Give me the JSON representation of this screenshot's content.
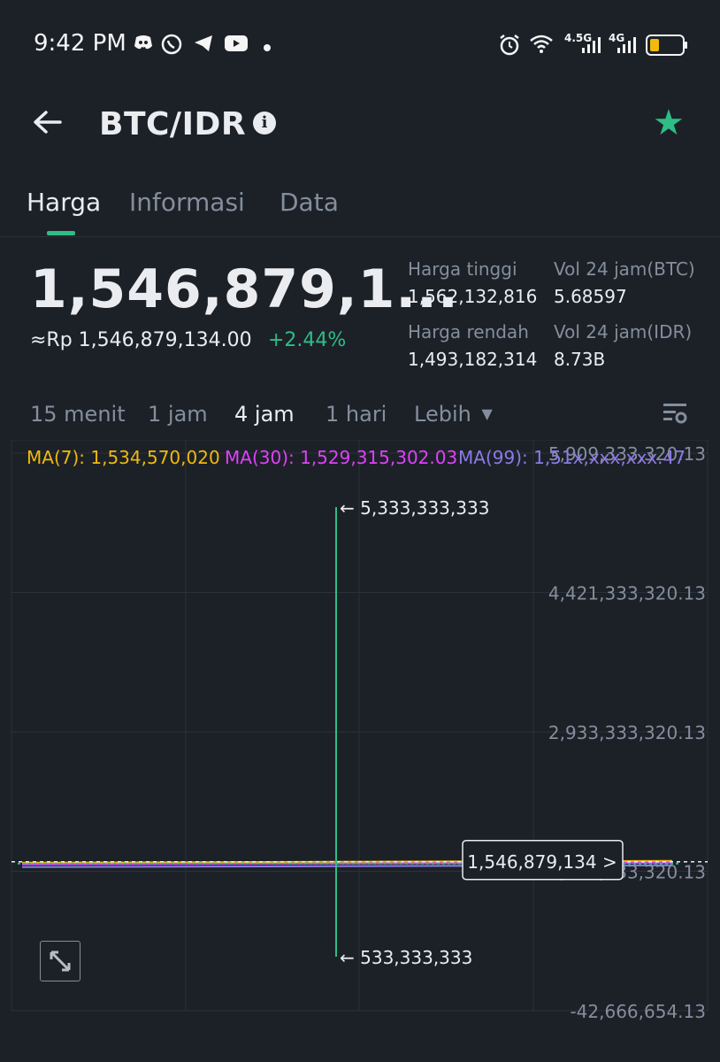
{
  "status_bar": {
    "time": "9:42 PM",
    "network_1": "4.5G",
    "network_2": "4G"
  },
  "header": {
    "title": "BTC/IDR",
    "favorite": true
  },
  "tabs": [
    {
      "label": "Harga",
      "active": true
    },
    {
      "label": "Informasi",
      "active": false
    },
    {
      "label": "Data",
      "active": false
    }
  ],
  "price": {
    "last": "1,546,879,1...",
    "rp_value": "≈Rp 1,546,879,134.00",
    "change": "+2.44%"
  },
  "stats": {
    "high_label": "Harga tinggi",
    "high_value": "1,562,132,816",
    "low_label": "Harga rendah",
    "low_value": "1,493,182,314",
    "vol_btc_label": "Vol 24 jam(BTC)",
    "vol_btc_value": "5.68597",
    "vol_idr_label": "Vol 24 jam(IDR)",
    "vol_idr_value": "8.73B"
  },
  "intervals": [
    {
      "label": "15 menit",
      "active": false
    },
    {
      "label": "1 jam",
      "active": false
    },
    {
      "label": "4 jam",
      "active": true
    },
    {
      "label": "1 hari",
      "active": false
    },
    {
      "label": "Lebih",
      "active": false
    }
  ],
  "colors": {
    "up": "#2ebd85",
    "ma7": "#f0b90b",
    "ma30": "#e040fb",
    "ma99": "#8d7ae6",
    "background": "#1c2128"
  },
  "chart_data": {
    "type": "candlestick",
    "ma_legend": [
      {
        "label": "MA(7): 1,534,570,020",
        "color": "#f0b90b"
      },
      {
        "label": "MA(30): 1,529,315,302.03",
        "color": "#e040fb"
      },
      {
        "label": "MA(99): 1,51x,xxx,xxx.47",
        "color": "#8d7ae6"
      }
    ],
    "y_ticks": [
      "5,909,333,320.13",
      "4,421,333,320.13",
      "2,933,333,320.13",
      "1,445,333,320.13",
      "-42,666,654.13"
    ],
    "y_tick_values": [
      5909333320.13,
      4421333320.13,
      2933333320.13,
      1445333320.13,
      -42666654.13
    ],
    "spike": {
      "high": 5333333333,
      "low": 533333333,
      "high_label": "5,333,333,333",
      "low_label": "533,333,333"
    },
    "last_price": 1546879134,
    "last_price_label": "1,546,879,134 >",
    "ylim": [
      -42666654.13,
      5909333320.13
    ]
  }
}
